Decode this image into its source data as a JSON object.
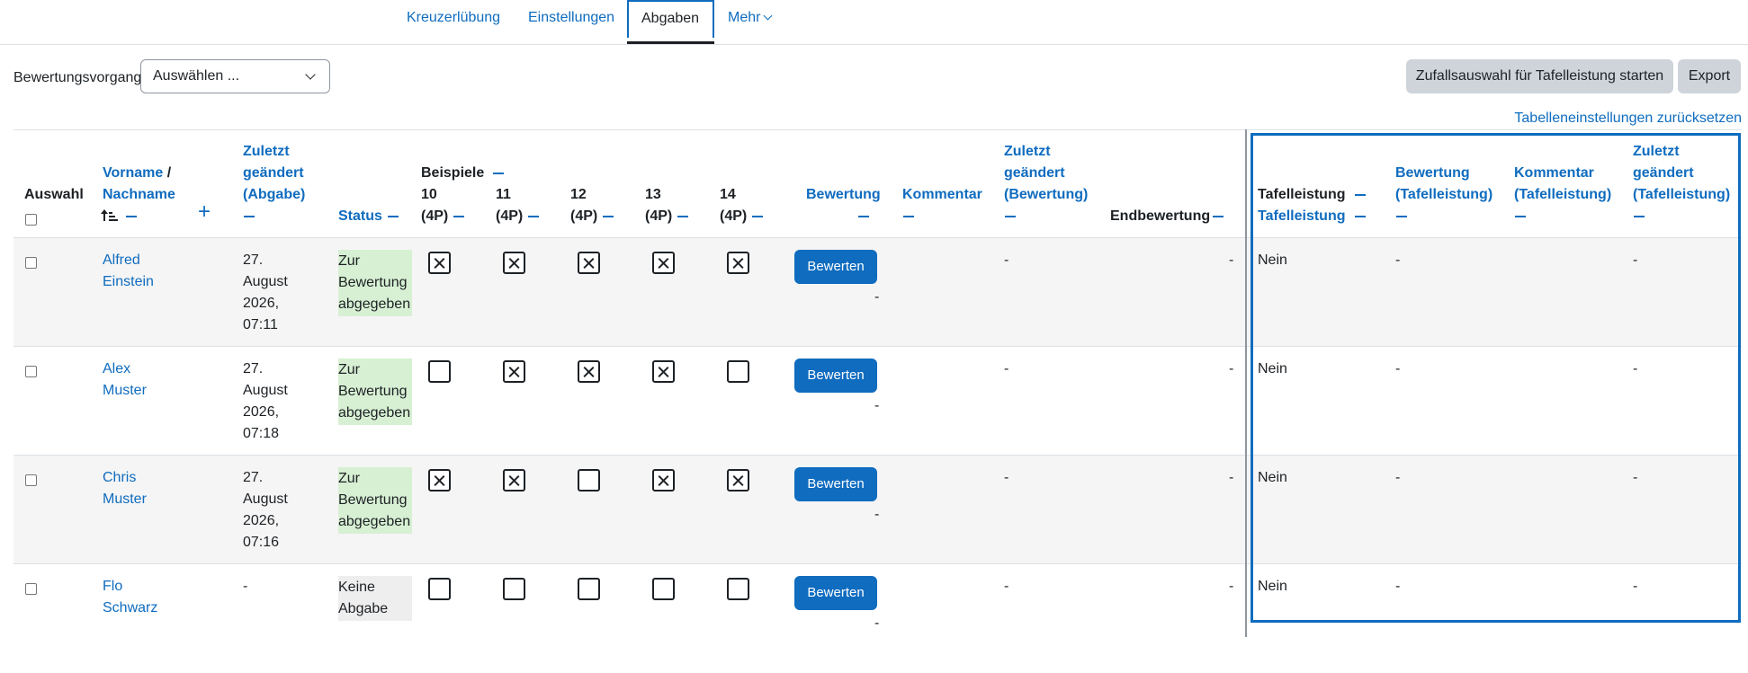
{
  "tabs": [
    {
      "label": "Kreuzerlübung"
    },
    {
      "label": "Einstellungen"
    },
    {
      "label": "Abgaben"
    },
    {
      "label": "Mehr"
    }
  ],
  "filter": {
    "label": "Bewertungsvorgang",
    "select_value": "Auswählen ..."
  },
  "buttons": {
    "random": "Zufallsauswahl für Tafelleistung starten",
    "export": "Export",
    "grade": "Bewerten"
  },
  "reset_link": "Tabelleneinstellungen zurücksetzen",
  "headers": {
    "auswahl": "Auswahl",
    "vorname": "Vorname",
    "slash": "/",
    "nachname": "Nachname",
    "zuletzt_abgabe": [
      "Zuletzt",
      "geändert",
      "(Abgabe)"
    ],
    "status": "Status",
    "beispiele": "Beispiele",
    "ex": [
      {
        "num": "10",
        "pts": "(4P)"
      },
      {
        "num": "11",
        "pts": "(4P)"
      },
      {
        "num": "12",
        "pts": "(4P)"
      },
      {
        "num": "13",
        "pts": "(4P)"
      },
      {
        "num": "14",
        "pts": "(4P)"
      }
    ],
    "bewertung": "Bewertung",
    "kommentar": "Kommentar",
    "zuletzt_bewertung": [
      "Zuletzt",
      "geändert",
      "(Bewertung)"
    ],
    "endbewertung": "Endbewertung",
    "tafel1": "Tafelleistung",
    "tafel2": "Tafelleistung",
    "bew_tafel": [
      "Bewertung",
      "(Tafelleistung)"
    ],
    "kom_tafel": [
      "Kommentar",
      "(Tafelleistung)"
    ],
    "zul_tafel": [
      "Zuletzt",
      "geändert",
      "(Tafelleistung)"
    ]
  },
  "rows": [
    {
      "first": "Alfred",
      "last": "Einstein",
      "date": [
        "27.",
        "August",
        "2026,",
        "07:11"
      ],
      "status": [
        "Zur",
        "Bewertung",
        "abgegeben"
      ],
      "status_color": "#d7f0d3",
      "checks": [
        true,
        true,
        true,
        true,
        true
      ],
      "grade": "-",
      "comment": "",
      "zul_bew": "-",
      "end": "-",
      "tafel": "Nein",
      "bew_t": "-",
      "kom_t": "",
      "zul_t": "-"
    },
    {
      "first": "Alex",
      "last": "Muster",
      "date": [
        "27.",
        "August",
        "2026,",
        "07:18"
      ],
      "status": [
        "Zur",
        "Bewertung",
        "abgegeben"
      ],
      "status_color": "#d7f0d3",
      "checks": [
        false,
        true,
        true,
        true,
        false
      ],
      "grade": "-",
      "comment": "",
      "zul_bew": "-",
      "end": "-",
      "tafel": "Nein",
      "bew_t": "-",
      "kom_t": "",
      "zul_t": "-"
    },
    {
      "first": "Chris",
      "last": "Muster",
      "date": [
        "27.",
        "August",
        "2026,",
        "07:16"
      ],
      "status": [
        "Zur",
        "Bewertung",
        "abgegeben"
      ],
      "status_color": "#d7f0d3",
      "checks": [
        true,
        true,
        false,
        true,
        true
      ],
      "grade": "-",
      "comment": "",
      "zul_bew": "-",
      "end": "-",
      "tafel": "Nein",
      "bew_t": "-",
      "kom_t": "",
      "zul_t": "-"
    },
    {
      "first": "Flo",
      "last": "Schwarz",
      "date": [
        "-"
      ],
      "status": [
        "Keine",
        "Abgabe"
      ],
      "status_color": "#eeeeee",
      "checks": [
        false,
        false,
        false,
        false,
        false
      ],
      "grade": "-",
      "comment": "",
      "zul_bew": "-",
      "end": "-",
      "tafel": "Nein",
      "bew_t": "-",
      "kom_t": "",
      "zul_t": "-"
    }
  ],
  "colors": {
    "accent": "#0f6cbf",
    "submitted_bg": "#d7f0d3",
    "none_bg": "#eeeeee"
  }
}
